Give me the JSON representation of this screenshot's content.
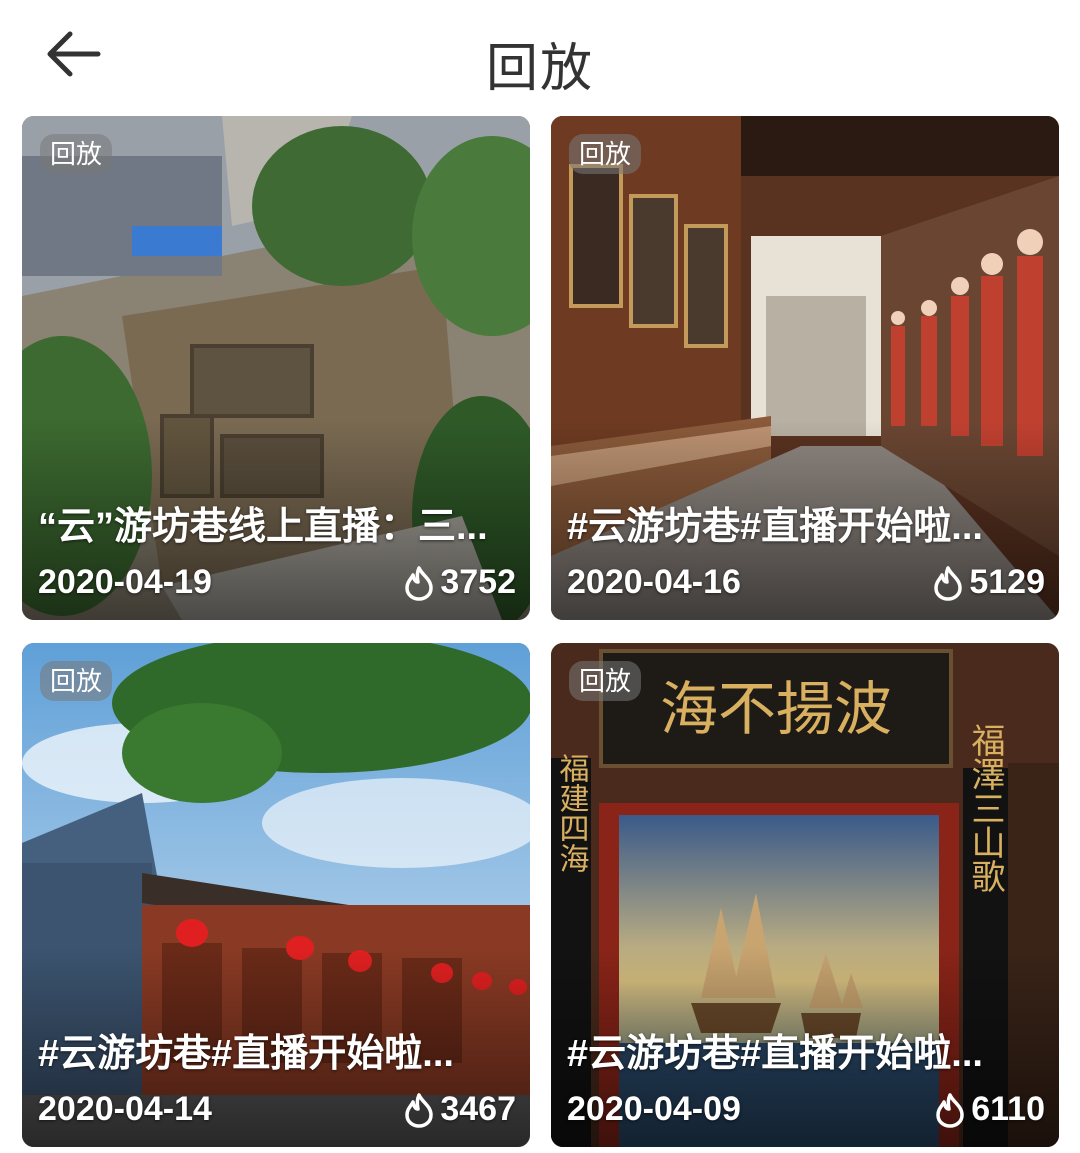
{
  "header": {
    "title": "回放",
    "back_icon": "back-arrow-icon"
  },
  "cards": [
    {
      "badge": "回放",
      "title": "“云”游坊巷线上直播：三...",
      "date": "2020-04-19",
      "views": "3752",
      "view_icon": "flame-icon"
    },
    {
      "badge": "回放",
      "title": "#云游坊巷#直播开始啦...",
      "date": "2020-04-16",
      "views": "5129",
      "view_icon": "flame-icon"
    },
    {
      "badge": "回放",
      "title": "#云游坊巷#直播开始啦...",
      "date": "2020-04-14",
      "views": "3467",
      "view_icon": "flame-icon"
    },
    {
      "badge": "回放",
      "title": "#云游坊巷#直播开始啦...",
      "date": "2020-04-09",
      "views": "6110",
      "view_icon": "flame-icon"
    }
  ],
  "scenes": {
    "plaque_text": "海不揚波",
    "pillar_left": "福建四海",
    "pillar_right": "福澤三山歌"
  }
}
